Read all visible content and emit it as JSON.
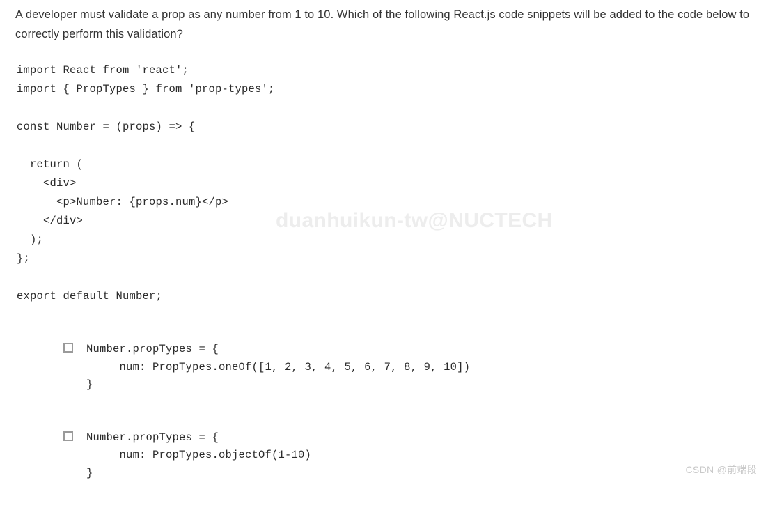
{
  "question": {
    "text": "A developer must validate a prop as any number from 1 to 10. Which of the following React.js code snippets will be added to the code below to correctly perform this validation?"
  },
  "code_snippet": {
    "lines": [
      "import React from 'react';",
      "import { PropTypes } from 'prop-types';",
      "",
      "const Number = (props) => {",
      "",
      "  return (",
      "    <div>",
      "      <p>Number: {props.num}</p>",
      "    </div>",
      "  );",
      "};",
      "",
      "export default Number;"
    ]
  },
  "options": [
    {
      "id": "option-a",
      "checked": false,
      "lines": [
        "Number.propTypes = {",
        "     num: PropTypes.oneOf([1, 2, 3, 4, 5, 6, 7, 8, 9, 10])",
        "}"
      ]
    },
    {
      "id": "option-b",
      "checked": false,
      "lines": [
        "Number.propTypes = {",
        "     num: PropTypes.objectOf(1-10)",
        "}"
      ]
    }
  ],
  "watermark": {
    "text": "duanhuikun-tw@NUCTECH",
    "color": "#ededed"
  },
  "attribution": {
    "text": "CSDN @前端段",
    "color": "#c9c9c9"
  },
  "colors": {
    "background": "#ffffff",
    "question_text": "#333333",
    "code_text": "#2b2b2b",
    "checkbox_border": "#9a9a9a"
  }
}
